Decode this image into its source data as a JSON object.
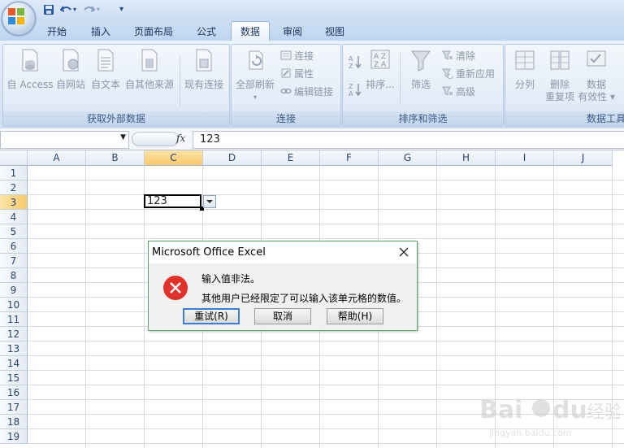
{
  "quick_access": {
    "items": [
      "save-icon",
      "undo-icon",
      "redo-icon",
      "customize-qat-icon"
    ]
  },
  "tabs": [
    {
      "label": "开始"
    },
    {
      "label": "插入"
    },
    {
      "label": "页面布局"
    },
    {
      "label": "公式"
    },
    {
      "label": "数据"
    },
    {
      "label": "审阅"
    },
    {
      "label": "视图"
    }
  ],
  "active_tab": "数据",
  "ribbon": {
    "external": {
      "label": "获取外部数据",
      "access": "自 Access",
      "web": "自网站",
      "text": "自文本",
      "other": "自其他来源",
      "existing": "现有连接"
    },
    "connections": {
      "label": "连接",
      "refresh_all": "全部刷新",
      "connections": "连接",
      "properties": "属性",
      "edit_links": "编辑链接"
    },
    "sort_filter": {
      "label": "排序和筛选",
      "sort": "排序...",
      "filter": "筛选",
      "clear": "清除",
      "reapply": "重新应用",
      "advanced": "高级"
    },
    "data_tools": {
      "label": "数据工具",
      "text_to_columns": "分列",
      "remove_dup_1": "删除",
      "remove_dup_2": "重复项",
      "validation_1": "数据",
      "validation_2": "有效性 ▾"
    }
  },
  "formula_bar": {
    "name_box": "",
    "fx": "fx",
    "content": "123"
  },
  "grid": {
    "columns": [
      "A",
      "B",
      "C",
      "D",
      "E",
      "F",
      "G",
      "H",
      "I",
      "J"
    ],
    "rows": [
      "1",
      "2",
      "3",
      "4",
      "5",
      "6",
      "7",
      "8",
      "9",
      "10",
      "11",
      "12",
      "13",
      "14",
      "15",
      "16",
      "17",
      "18",
      "19"
    ],
    "active_cell_value": "123",
    "selected_column": "C",
    "selected_row": "3"
  },
  "dialog": {
    "title": "Microsoft Office Excel",
    "message_1": "输入值非法。",
    "message_2": "其他用户已经限定了可以输入该单元格的数值。",
    "retry": "重试(R)",
    "cancel": "取消",
    "help": "帮助(H)"
  },
  "colors": {
    "accent": "#3c7fd2",
    "error_red": "#e0322a",
    "selection": "#f8c96b"
  }
}
